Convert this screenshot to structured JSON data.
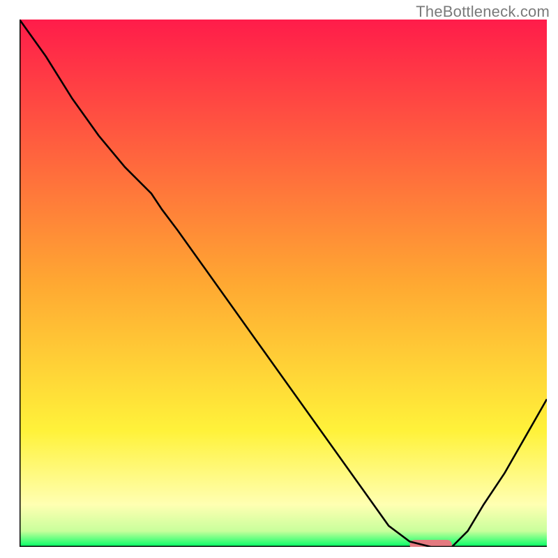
{
  "watermark": "TheBottleneck.com",
  "chart_data": {
    "type": "line",
    "title": "",
    "xlabel": "",
    "ylabel": "",
    "xlim": [
      0,
      100
    ],
    "ylim": [
      0,
      100
    ],
    "series": [
      {
        "name": "curve",
        "x": [
          0,
          5,
          10,
          15,
          20,
          25,
          27,
          30,
          35,
          40,
          45,
          50,
          55,
          60,
          65,
          70,
          74,
          78,
          82,
          85,
          88,
          92,
          96,
          100
        ],
        "values": [
          100,
          93,
          85,
          78,
          72,
          67,
          64,
          60,
          53,
          46,
          39,
          32,
          25,
          18,
          11,
          4,
          1,
          0,
          0,
          3,
          8,
          14,
          21,
          28
        ]
      }
    ],
    "marker": {
      "x_start": 74,
      "x_end": 82,
      "y": 0,
      "color": "#e47a80"
    },
    "gradient_stops": [
      {
        "y": 0.0,
        "color": "#ff1c4a"
      },
      {
        "y": 0.5,
        "color": "#ffa832"
      },
      {
        "y": 0.78,
        "color": "#fff23a"
      },
      {
        "y": 0.92,
        "color": "#ffffb2"
      },
      {
        "y": 0.97,
        "color": "#c9ff9c"
      },
      {
        "y": 1.0,
        "color": "#00ff66"
      }
    ],
    "axis_color": "#000000",
    "curve_color": "#000000"
  }
}
